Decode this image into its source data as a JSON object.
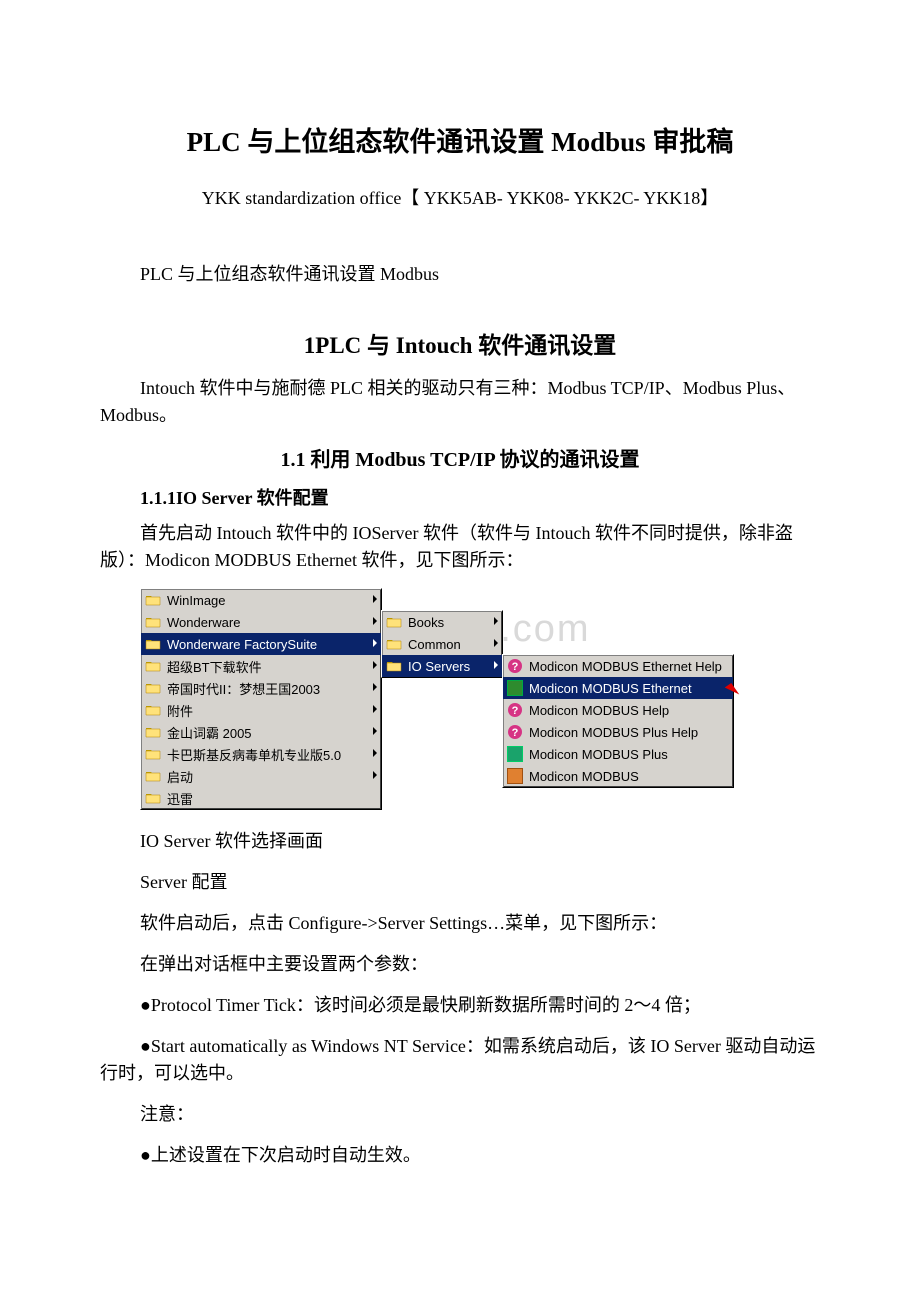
{
  "doc": {
    "title": "PLC 与上位组态软件通讯设置 Modbus 审批稿",
    "office": "YKK standardization office【 YKK5AB- YKK08- YKK2C- YKK18】",
    "subtitle": "PLC 与上位组态软件通讯设置 Modbus",
    "h2": "1PLC 与 Intouch 软件通讯设置",
    "p1": "Intouch 软件中与施耐德 PLC 相关的驱动只有三种：Modbus TCP/IP、Modbus Plus、Modbus。",
    "h3": "1.1 利用 Modbus TCP/IP 协议的通讯设置",
    "h4": "1.1.1IO Server 软件配置",
    "p2": "首先启动 Intouch 软件中的 IOServer 软件（软件与 Intouch 软件不同时提供，除非盗版）：Modicon MODBUS Ethernet 软件，见下图所示：",
    "caption1": "IO Server 软件选择画面",
    "caption2": "Server 配置",
    "p3": "软件启动后，点击 Configure->Server Settings…菜单，见下图所示：",
    "p4": "在弹出对话框中主要设置两个参数：",
    "p5": "●Protocol Timer Tick：该时间必须是最快刷新数据所需时间的 2～4 倍；",
    "p6": "●Start automatically as Windows NT Service：如需系统启动后，该 IO Server 驱动自动运行时，可以选中。",
    "p7": "注意：",
    "p8": "●上述设置在下次启动时自动生效。"
  },
  "menu": {
    "watermark": "www.bdocx.com",
    "col1": [
      {
        "label": "WinImage",
        "arrow": true
      },
      {
        "label": "Wonderware",
        "arrow": true
      },
      {
        "label": "Wonderware FactorySuite",
        "arrow": true,
        "sel": true
      },
      {
        "label": "超级BT下载软件",
        "arrow": true
      },
      {
        "label": "帝国时代II：梦想王国2003",
        "arrow": true
      },
      {
        "label": "附件",
        "arrow": true
      },
      {
        "label": "金山词霸 2005",
        "arrow": true
      },
      {
        "label": "卡巴斯基反病毒单机专业版5.0",
        "arrow": true
      },
      {
        "label": "启动",
        "arrow": true
      },
      {
        "label": "迅雷",
        "arrow": false
      }
    ],
    "col2": [
      {
        "label": "Books",
        "arrow": true,
        "icon": "folder"
      },
      {
        "label": "Common",
        "arrow": true,
        "icon": "folder"
      },
      {
        "label": "IO Servers",
        "arrow": true,
        "icon": "folder",
        "sel": true
      }
    ],
    "col3": [
      {
        "label": "Modicon MODBUS Ethernet Help",
        "icon": "help"
      },
      {
        "label": "Modicon MODBUS Ethernet",
        "icon": "net",
        "sel": true
      },
      {
        "label": "Modicon MODBUS Help",
        "icon": "help"
      },
      {
        "label": "Modicon MODBUS Plus Help",
        "icon": "help"
      },
      {
        "label": "Modicon MODBUS Plus",
        "icon": "mod"
      },
      {
        "label": "Modicon MODBUS",
        "icon": "plus"
      }
    ]
  }
}
